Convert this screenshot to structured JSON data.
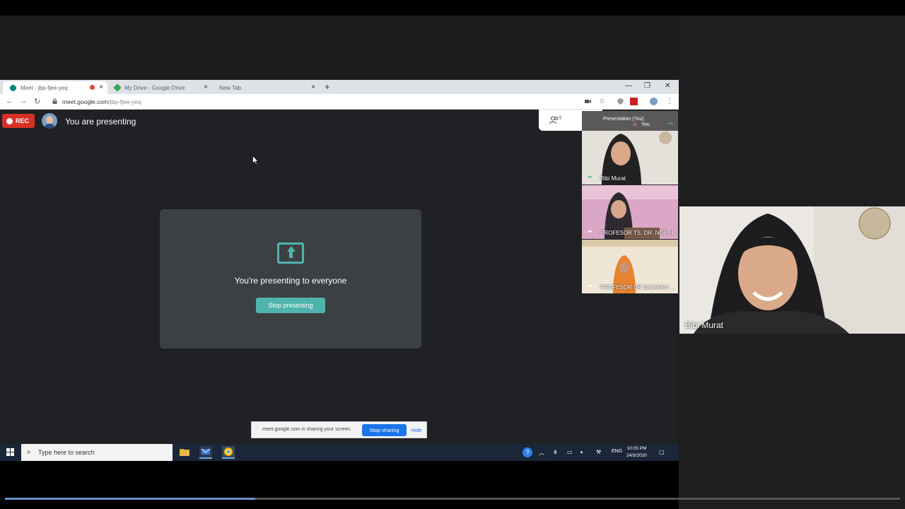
{
  "browser": {
    "tabs": [
      {
        "label": "Meet - jbp-fjee-yeq",
        "active": true
      },
      {
        "label": "My Drive - Google Drive",
        "active": false
      },
      {
        "label": "New Tab",
        "active": false
      }
    ],
    "url_host": "meet.google.com",
    "url_path": "/jbp-fjee-yeq"
  },
  "meet": {
    "rec_label": "REC",
    "presenting_label": "You are presenting",
    "people_count": "5",
    "card_title": "You're presenting to everyone",
    "stop_presenting_label": "Stop presenting",
    "presentation_tile_label": "Presentation (You)",
    "you_label": "You",
    "participants": [
      {
        "name": "Bibi Murat"
      },
      {
        "name": "PROFESOR TS. DR. NOR H..."
      },
      {
        "name": "PROFESOR DR SALMIAH ..."
      }
    ],
    "main_video_name": "Bibi Murat"
  },
  "sharebar": {
    "message": "meet.google.com is sharing your screen.",
    "stop_label": "Stop sharing",
    "hide_label": "Hide"
  },
  "taskbar": {
    "search_placeholder": "Type here to search",
    "lang": "ENG",
    "time": "10:05 PM",
    "date": "24/3/2020"
  },
  "video_progress": 0.28,
  "colors": {
    "accent_teal": "#4fb4ad",
    "rec_red": "#d93025",
    "share_blue": "#1a73e8"
  }
}
